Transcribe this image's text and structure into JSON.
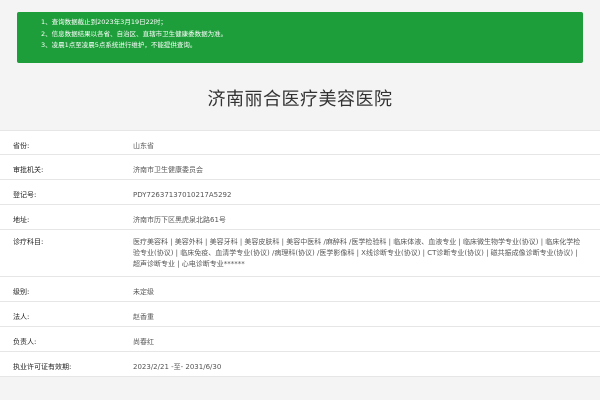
{
  "notice": {
    "lines": [
      "1、查询数据截止到2023年3月19日22时；",
      "2、信息数据结果以各省、自治区、直辖市卫生健康委数据为准。",
      "3、凌晨1点至凌晨5点系统进行维护，不能提供查询。"
    ]
  },
  "hospital": {
    "name": "济南丽合医疗美容医院"
  },
  "fields": [
    {
      "label": "省份:",
      "value": "山东省"
    },
    {
      "label": "审批机关:",
      "value": "济南市卫生健康委员会"
    },
    {
      "label": "登记号:",
      "value": "PDY72637137010217A5292"
    },
    {
      "label": "地址:",
      "value": "济南市历下区黑虎泉北路61号"
    },
    {
      "label": "诊疗科目:",
      "value": "医疗美容科 | 美容外科 | 美容牙科 | 美容皮肤科 | 美容中医科 /麻醉科 /医学检验科 | 临床体液、血液专业 | 临床微生物学专业(协议) | 临床化学检验专业(协议) | 临床免疫、血清学专业(协议) /病理科(协议) /医学影像科 | X线诊断专业(协议) | CT诊断专业(协议) | 磁共振成像诊断专业(协议) | 超声诊断专业 | 心电诊断专业******"
    },
    {
      "label": "级别:",
      "value": "未定级"
    },
    {
      "label": "法人:",
      "value": "赵香重"
    },
    {
      "label": "负责人:",
      "value": "尚春红"
    },
    {
      "label": "执业许可证有效期:",
      "value": "2023/2/21 -至- 2031/6/30"
    }
  ]
}
